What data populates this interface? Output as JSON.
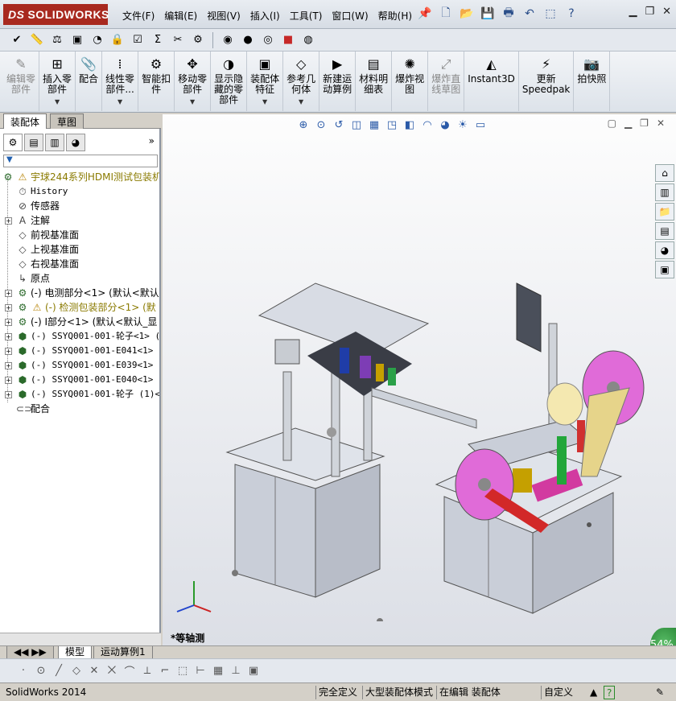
{
  "app": {
    "logo": "SOLIDWORKS",
    "logo_prefix": "DS"
  },
  "menu": [
    "文件(F)",
    "编辑(E)",
    "视图(V)",
    "插入(I)",
    "工具(T)",
    "窗口(W)",
    "帮助(H)"
  ],
  "command_manager": [
    {
      "label": "编辑零\n部件",
      "icon": "edit-component-icon",
      "disabled": true
    },
    {
      "label": "插入零\n部件",
      "icon": "insert-component-icon",
      "arrow": true
    },
    {
      "label": "配合",
      "icon": "mate-icon"
    },
    {
      "label": "线性零\n部件...",
      "icon": "linear-pattern-icon",
      "arrow": true
    },
    {
      "label": "智能扣\n件",
      "icon": "smart-fastener-icon"
    },
    {
      "label": "移动零\n部件",
      "icon": "move-component-icon",
      "arrow": true
    },
    {
      "label": "显示隐\n藏的零\n部件",
      "icon": "show-hidden-icon"
    },
    {
      "label": "装配体\n特征",
      "icon": "assembly-feature-icon",
      "arrow": true
    },
    {
      "label": "参考几\n何体",
      "icon": "reference-geometry-icon",
      "arrow": true
    },
    {
      "label": "新建运\n动算例",
      "icon": "motion-study-icon"
    },
    {
      "label": "材料明\n细表",
      "icon": "bom-icon"
    },
    {
      "label": "爆炸视\n图",
      "icon": "exploded-view-icon"
    },
    {
      "label": "爆炸直\n线草图",
      "icon": "explode-line-icon",
      "disabled": true
    },
    {
      "label": "Instant3D",
      "icon": "instant3d-icon"
    },
    {
      "label": "更新\nSpeedpak",
      "icon": "speedpak-icon"
    },
    {
      "label": "拍快照",
      "icon": "snapshot-icon"
    }
  ],
  "left_tabs": {
    "assembly": "装配体",
    "sketch": "草图"
  },
  "tree": [
    {
      "label": "宇球244系列HDMI测试包装机",
      "icon": "assembly-icon",
      "warn": true,
      "level": 0
    },
    {
      "label": "History",
      "icon": "history-icon",
      "level": 1,
      "mono": true
    },
    {
      "label": "传感器",
      "icon": "sensor-icon",
      "level": 1
    },
    {
      "label": "注解",
      "icon": "annotation-icon",
      "level": 1,
      "expand": true
    },
    {
      "label": "前视基准面",
      "icon": "plane-icon",
      "level": 1
    },
    {
      "label": "上视基准面",
      "icon": "plane-icon",
      "level": 1
    },
    {
      "label": "右视基准面",
      "icon": "plane-icon",
      "level": 1
    },
    {
      "label": "原点",
      "icon": "origin-icon",
      "level": 1
    },
    {
      "label": "(-) 电测部分<1> (默认<默认",
      "icon": "subassembly-icon",
      "level": 1,
      "expand": true
    },
    {
      "label": "(-) 检测包装部分<1> (默",
      "icon": "subassembly-icon",
      "level": 1,
      "expand": true,
      "warn": true
    },
    {
      "label": "(-) I部分<1> (默认<默认_显",
      "icon": "subassembly-icon",
      "level": 1,
      "expand": true
    },
    {
      "label": "(-) SSYQ001-001-轮子<1> (",
      "icon": "part-icon",
      "level": 1,
      "expand": true,
      "mono": true
    },
    {
      "label": "(-) SSYQ001-001-E041<1> (",
      "icon": "part-icon",
      "level": 1,
      "expand": true,
      "mono": true
    },
    {
      "label": "(-) SSYQ001-001-E039<1> (",
      "icon": "part-icon",
      "level": 1,
      "expand": true,
      "mono": true
    },
    {
      "label": "(-) SSYQ001-001-E040<1> (",
      "icon": "part-icon",
      "level": 1,
      "expand": true,
      "mono": true
    },
    {
      "label": "(-) SSYQ001-001-轮子 (1)<1",
      "icon": "part-icon",
      "level": 1,
      "expand": true,
      "mono": true
    },
    {
      "label": "配合",
      "icon": "mates-icon",
      "level": 1
    }
  ],
  "bottom_tabs": {
    "model": "模型",
    "motion": "运动算例1"
  },
  "viewport": {
    "view_name": "*等轴测",
    "percent": "54%"
  },
  "status": {
    "app_version": "SolidWorks 2014",
    "defined": "完全定义",
    "large_mode": "大型装配体模式",
    "editing": "在编辑 装配体",
    "custom": "自定义",
    "help": "?"
  },
  "colors": {
    "logo": "#a8291f",
    "accent": "#2a5aa8",
    "warn": "#b8860b"
  }
}
